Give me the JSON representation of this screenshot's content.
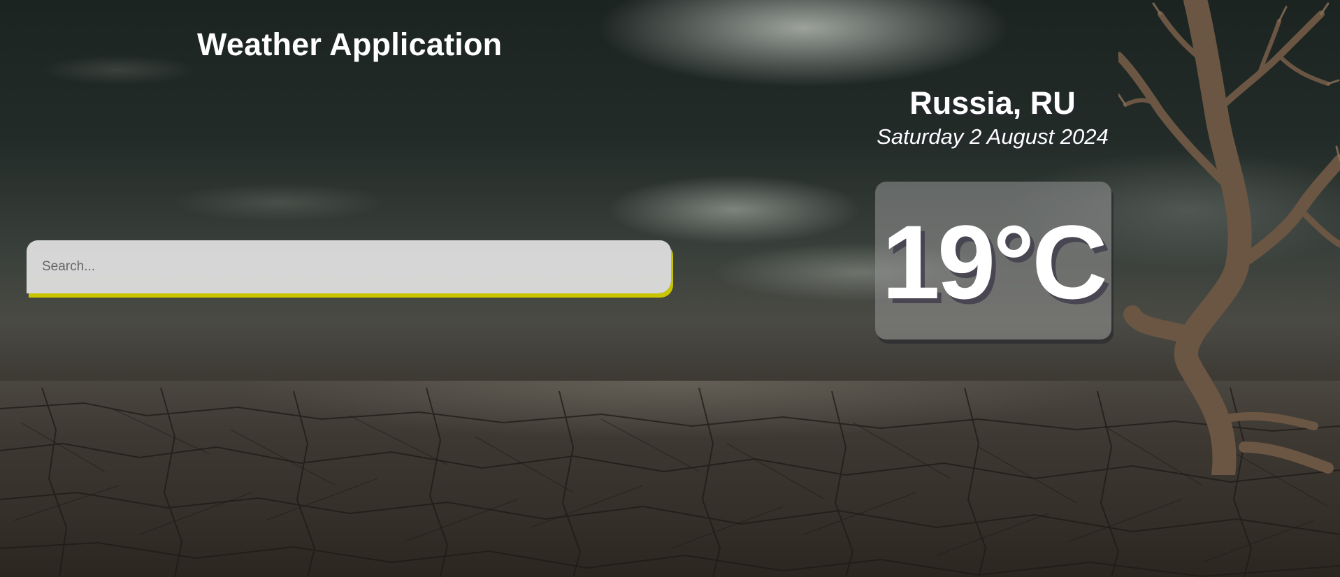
{
  "header": {
    "title": "Weather Application"
  },
  "search": {
    "placeholder": "Search...",
    "value": "",
    "accent_color": "#c9c400"
  },
  "weather": {
    "location": "Russia, RU",
    "date": "Saturday 2 August 2024",
    "temperature": "19°C"
  },
  "background": {
    "scene": "dark cloudy sky over cracked dry earth with a dead tree"
  }
}
